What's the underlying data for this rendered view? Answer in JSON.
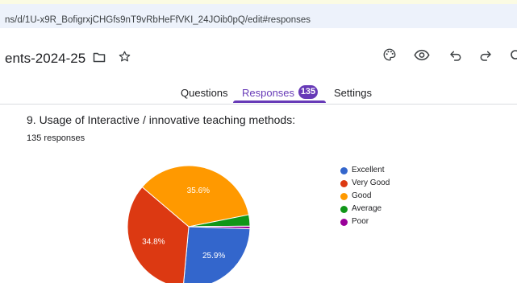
{
  "browser": {
    "url": "ns/d/1U-x9R_BofigrxjCHGfs9nT9vRbHeFfVKI_24JOib0pQ/edit#responses"
  },
  "header": {
    "doc_title": "ents-2024-25",
    "icons": [
      "folder-icon",
      "star-icon",
      "palette-icon",
      "eye-icon",
      "undo-icon",
      "redo-icon",
      "more-icon"
    ]
  },
  "tabs": {
    "questions": "Questions",
    "responses": "Responses",
    "responses_count": "135",
    "settings": "Settings"
  },
  "question": {
    "title": "9. Usage of Interactive / innovative teaching methods:",
    "response_count": "135 responses"
  },
  "chart_data": {
    "type": "pie",
    "categories": [
      "Excellent",
      "Very Good",
      "Good",
      "Average",
      "Poor"
    ],
    "values": [
      25.9,
      34.8,
      35.6,
      3.0,
      0.7
    ],
    "labels": [
      "25.9%",
      "34.8%",
      "35.6%",
      "",
      ""
    ],
    "colors": [
      "#3366cc",
      "#dc3912",
      "#ff9900",
      "#109618",
      "#990099"
    ],
    "legend_position": "right"
  }
}
